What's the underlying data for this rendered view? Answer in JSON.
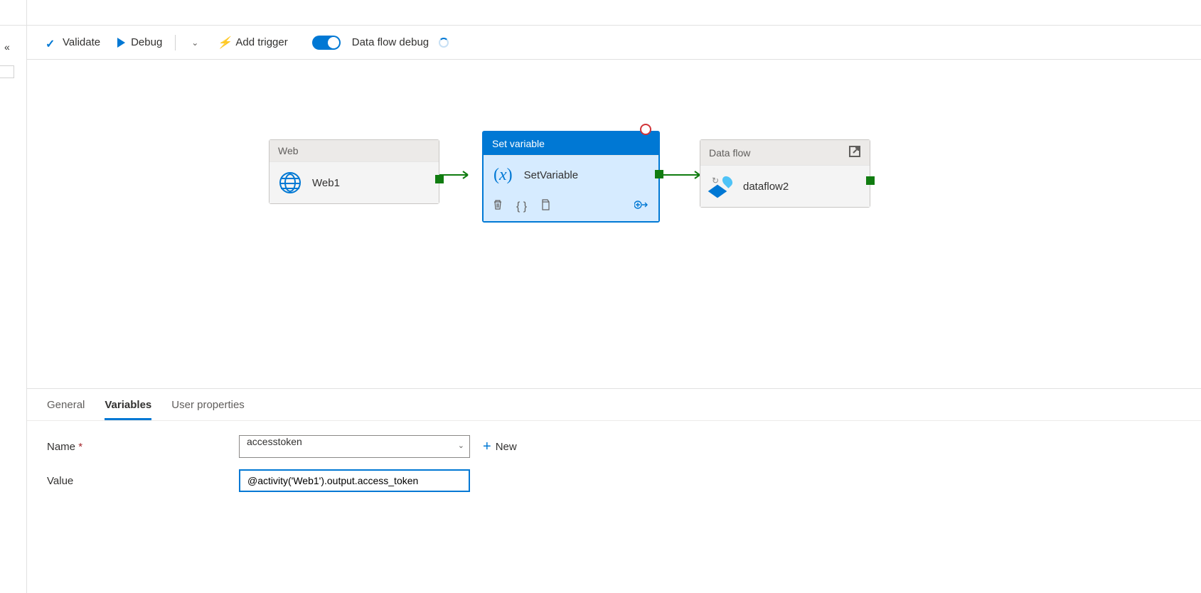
{
  "toolbar": {
    "validate": "Validate",
    "debug": "Debug",
    "add_trigger": "Add trigger",
    "dataflow_debug": "Data flow debug"
  },
  "nodes": {
    "web": {
      "header": "Web",
      "title": "Web1"
    },
    "setvar": {
      "header": "Set variable",
      "title": "SetVariable"
    },
    "dataflow": {
      "header": "Data flow",
      "title": "dataflow2"
    }
  },
  "tabs": {
    "general": "General",
    "variables": "Variables",
    "user_properties": "User properties"
  },
  "form": {
    "name_label": "Name",
    "name_value": "accesstoken",
    "new_label": "New",
    "value_label": "Value",
    "value_value": "@activity('Web1').output.access_token"
  }
}
